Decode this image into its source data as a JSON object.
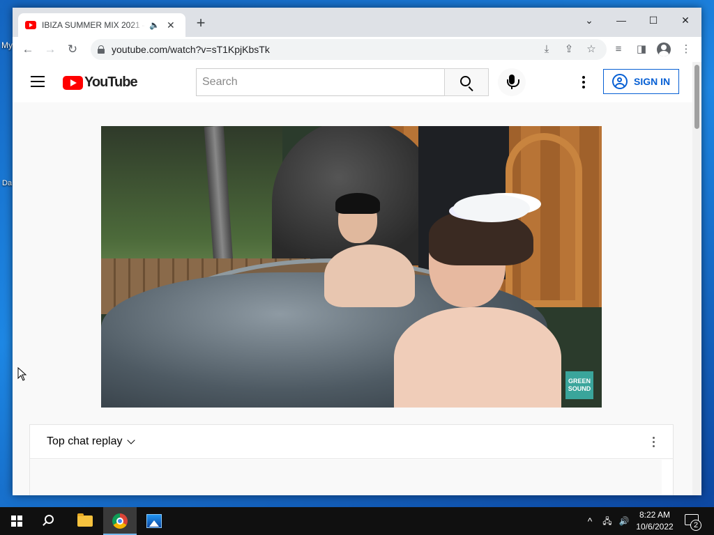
{
  "desktop": {
    "labels": [
      "My",
      "Da"
    ]
  },
  "browser": {
    "tab": {
      "title": "IBIZA SUMMER MIX 2021 –",
      "audio_icon": "speaker-icon",
      "close_glyph": "✕"
    },
    "new_tab_glyph": "+",
    "window_controls": {
      "tab_search": "⌄",
      "minimize": "—",
      "maximize": "☐",
      "close": "✕"
    },
    "toolbar": {
      "back": "←",
      "forward": "→",
      "reload": "↻",
      "url": "youtube.com/watch?v=sT1KpjKbsTk",
      "install_icon": "⤓",
      "share_icon": "⇪",
      "bookmark_icon": "☆",
      "media_icon": "≡",
      "sidepanel_icon": "◨",
      "menu_icon": "⋮"
    }
  },
  "youtube": {
    "logo_text": "YouTube",
    "search": {
      "placeholder": "Search"
    },
    "sign_in_label": "SIGN IN",
    "video": {
      "watermark": "GREEN SOUND"
    },
    "chat": {
      "title": "Top chat replay"
    }
  },
  "taskbar": {
    "apps": [
      "start",
      "search",
      "file-explorer",
      "chrome",
      "photos"
    ],
    "tray": {
      "chevron": "^",
      "network": "🖧",
      "volume": "🔊"
    },
    "clock": {
      "time": "8:22 AM",
      "date": "10/6/2022"
    },
    "notification_count": "2"
  },
  "colors": {
    "youtube_red": "#ff0000",
    "signin_blue": "#065fd4",
    "taskbar": "#101010",
    "desktop_blue": "#1e88e5"
  }
}
